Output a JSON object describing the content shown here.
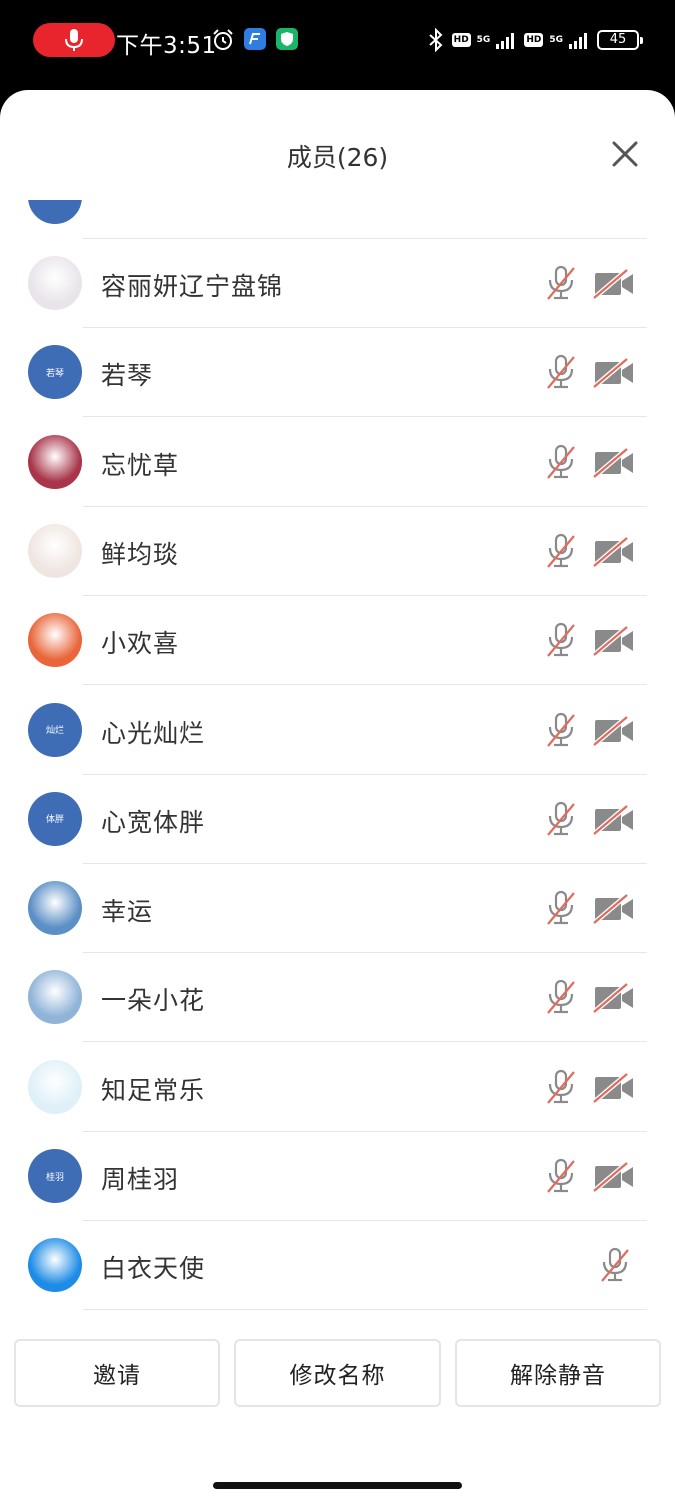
{
  "status_bar": {
    "time": "下午3:51",
    "battery": "45",
    "hd1": "HD",
    "hd2": "HD",
    "net1": "5G",
    "net2": "5G"
  },
  "header": {
    "title": "成员(26)"
  },
  "members": [
    {
      "name": "容丽妍辽宁盘锦",
      "avatar_type": "photo",
      "avatar_bg": "#e9e4ea",
      "mic_muted": true,
      "cam_off": true
    },
    {
      "name": "若琴",
      "avatar_type": "initials",
      "avatar_text": "若琴",
      "avatar_bg": "#3e6cb5",
      "mic_muted": true,
      "cam_off": true
    },
    {
      "name": "忘忧草",
      "avatar_type": "photo",
      "avatar_bg": "#a8354a",
      "mic_muted": true,
      "cam_off": true
    },
    {
      "name": "鲜均琰",
      "avatar_type": "photo",
      "avatar_bg": "#efe6e1",
      "mic_muted": true,
      "cam_off": true
    },
    {
      "name": "小欢喜",
      "avatar_type": "photo",
      "avatar_bg": "#e9653a",
      "mic_muted": true,
      "cam_off": true
    },
    {
      "name": "心光灿烂",
      "avatar_type": "initials",
      "avatar_text": "灿烂",
      "avatar_bg": "#3e6cb5",
      "mic_muted": true,
      "cam_off": true
    },
    {
      "name": "心宽体胖",
      "avatar_type": "initials",
      "avatar_text": "体胖",
      "avatar_bg": "#3e6cb5",
      "mic_muted": true,
      "cam_off": true
    },
    {
      "name": "幸运",
      "avatar_type": "photo",
      "avatar_bg": "#5b8fc6",
      "mic_muted": true,
      "cam_off": true
    },
    {
      "name": "一朵小花",
      "avatar_type": "photo",
      "avatar_bg": "#8fb4d8",
      "mic_muted": true,
      "cam_off": true
    },
    {
      "name": "知足常乐",
      "avatar_type": "photo",
      "avatar_bg": "#dff0f8",
      "mic_muted": true,
      "cam_off": true
    },
    {
      "name": "周桂羽",
      "avatar_type": "initials",
      "avatar_text": "桂羽",
      "avatar_bg": "#3e6cb5",
      "mic_muted": true,
      "cam_off": true
    },
    {
      "name": "白衣天使",
      "avatar_type": "photo",
      "avatar_bg": "#1d8ce6",
      "mic_muted": true,
      "cam_off": null
    }
  ],
  "buttons": {
    "invite": "邀请",
    "rename": "修改名称",
    "unmute": "解除静音"
  },
  "colors": {
    "muted_slash": "#e06b5e",
    "icon_gray": "#8a8a8a",
    "default_avatar": "#3e6cb5"
  }
}
